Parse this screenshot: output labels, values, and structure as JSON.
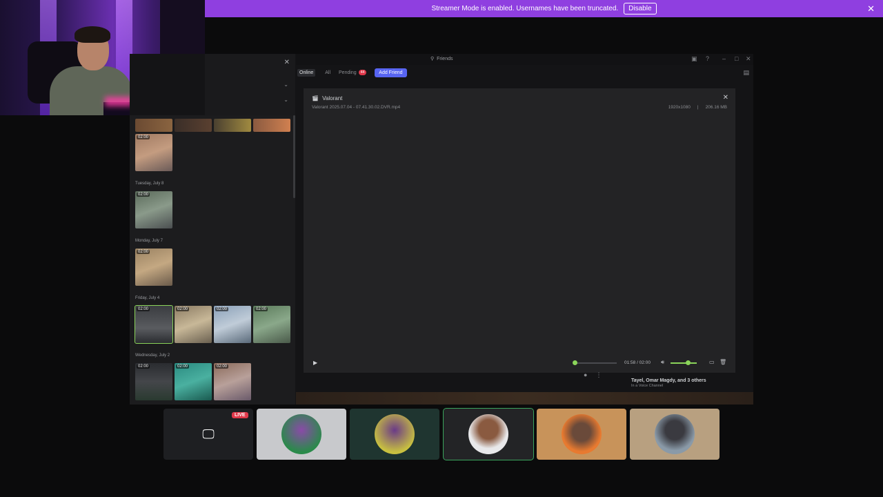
{
  "banner": {
    "message": "Streamer Mode is enabled. Usernames have been truncated.",
    "button": "Disable"
  },
  "window": {
    "title": "Friends",
    "tabs": [
      {
        "label": "Online",
        "active": true
      },
      {
        "label": "All",
        "active": false
      }
    ],
    "pending_label": "Pending",
    "pending_count": "44",
    "add_friend": "Add Friend"
  },
  "clips": {
    "groups": [
      {
        "label": "Tuesday, July 8"
      },
      {
        "label": "Monday, July 7"
      },
      {
        "label": "Friday, July 4"
      },
      {
        "label": "Wednesday, July 2"
      }
    ],
    "duration": "02:00"
  },
  "viewer": {
    "game": "Valorant",
    "file": "Valorant 2025.07.04 - 07.41.30.02.DVR.mp4",
    "resolution": "1920x1080",
    "separator": "|",
    "size": "206.16 MB",
    "time": "01:58 / 02:00",
    "progress": 0.02,
    "volume": 0.65
  },
  "voice": {
    "names": "Tayel, Omar Magdy, and 3 others",
    "subtitle": "In a Voice Channel"
  },
  "call": {
    "live_badge": "LIVE"
  },
  "colors": {
    "banner": "#8f3fe0",
    "accent": "#5865f2",
    "green": "#8bd55a",
    "live": "#e0384a"
  }
}
